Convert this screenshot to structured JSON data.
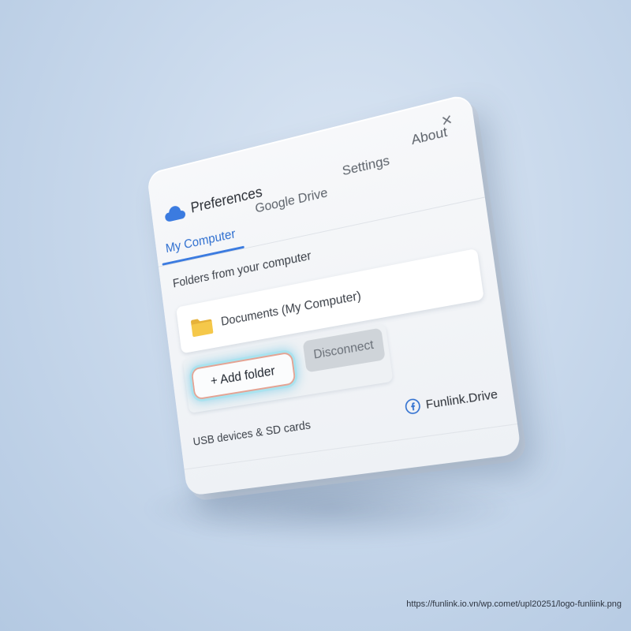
{
  "window": {
    "title": "Preferences",
    "close_symbol": "×"
  },
  "tabs": [
    {
      "label": "My Computer",
      "active": true
    },
    {
      "label": "Google Drive",
      "active": false
    },
    {
      "label": "Settings",
      "active": false
    },
    {
      "label": "About",
      "active": false
    }
  ],
  "main": {
    "section_title": "Folders from your computer",
    "folder_item": {
      "name": "Documents (My Computer)",
      "icon": "folder-icon"
    },
    "add_folder_label": "+ Add folder",
    "disconnect_label": "Disconnect",
    "usb_label": "USB devices & SD cards"
  },
  "brand": {
    "name": "Funlink.Drive",
    "icon": "brand-circle-f-icon"
  },
  "watermark": "https://funlink.io.vn/wp.comet/upl20251/logo-funliink.png",
  "colors": {
    "accent": "#3b7be0",
    "active_tab_text": "#2f6fd0",
    "folder_yellow": "#f5c84a",
    "highlight_glow": "#a9e3ef",
    "highlight_border": "#e5a393",
    "disconnect_bg": "#cfd4d9",
    "background": "#c9d9ec"
  }
}
